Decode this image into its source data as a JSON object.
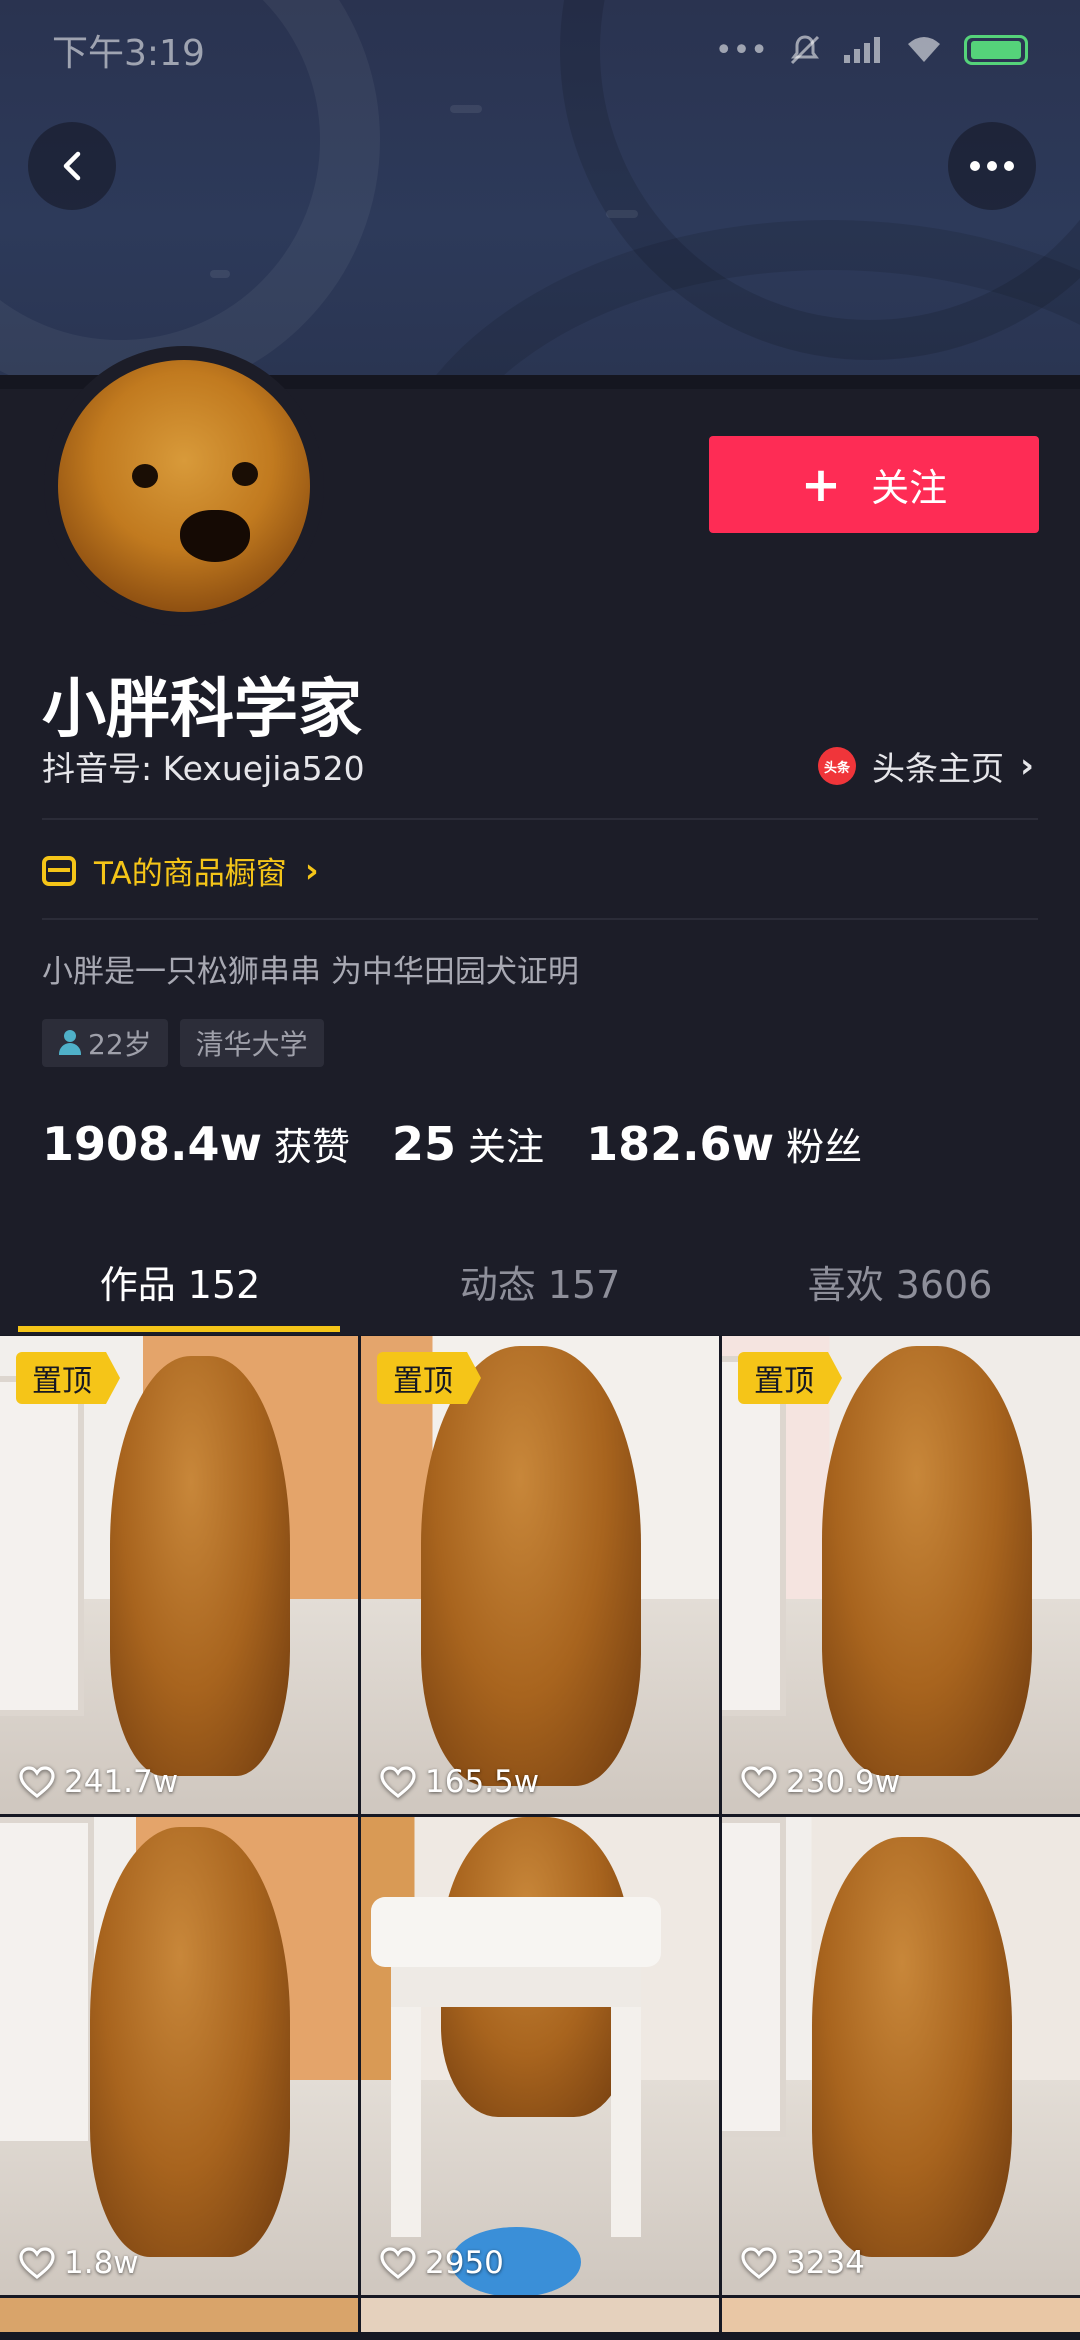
{
  "status_bar": {
    "time": "下午3:19",
    "signal_dots": "•••"
  },
  "profile": {
    "name": "小胖科学家",
    "douyin_id": "抖音号: Kexuejia520",
    "toutiao_link": "头条主页",
    "toutiao_logo_text": "头条",
    "follow_label": "关注",
    "shop_label": "TA的商品橱窗",
    "bio": "小胖是一只松狮串串 为中华田园犬证明",
    "tags": [
      "22岁",
      "清华大学"
    ],
    "stats": [
      {
        "value": "1908.4w",
        "label": "获赞"
      },
      {
        "value": "25",
        "label": "关注"
      },
      {
        "value": "182.6w",
        "label": "粉丝"
      }
    ]
  },
  "tabs": [
    {
      "label": "作品 152",
      "active": true
    },
    {
      "label": "动态 157",
      "active": false
    },
    {
      "label": "喜欢 3606",
      "active": false
    }
  ],
  "videos": [
    {
      "pinned": true,
      "pin_label": "置顶",
      "likes": "241.7w"
    },
    {
      "pinned": true,
      "pin_label": "置顶",
      "likes": "165.5w"
    },
    {
      "pinned": true,
      "pin_label": "置顶",
      "likes": "230.9w"
    },
    {
      "pinned": false,
      "likes": "1.8w"
    },
    {
      "pinned": false,
      "likes": "2950"
    },
    {
      "pinned": false,
      "likes": "3234"
    }
  ],
  "colors": {
    "accent_red": "#fe2c55",
    "accent_yellow": "#f5c518",
    "background": "#161823"
  }
}
